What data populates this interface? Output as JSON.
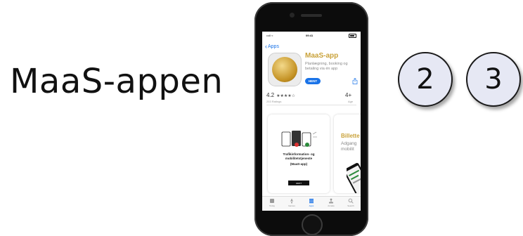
{
  "slide": {
    "title": "MaaS-appen",
    "steps": [
      "2",
      "3"
    ]
  },
  "status_bar": {
    "time": "09:41",
    "signal": "•••ll ≈"
  },
  "store": {
    "back_label": "Apps",
    "app_name": "MaaS-app",
    "app_subtitle": "Planlægning, booking og betaling via én app",
    "get_label": "HENT",
    "rating": "4.2",
    "stars": "★★★★☆",
    "ratings_count": "253 Ratings",
    "age": "4+",
    "age_label": "Age"
  },
  "cards": {
    "card1_title": "Trafikinformation- og mobilitetstjeneste",
    "card1_sub": "(MaaS-app)",
    "card1_button": "HENT",
    "card2_title": "Billette",
    "card2_line1": "Adgang",
    "card2_line2": "mobilit"
  },
  "tabs": [
    {
      "id": "today",
      "label": "Today"
    },
    {
      "id": "games",
      "label": "Games"
    },
    {
      "id": "apps",
      "label": "Apps"
    },
    {
      "id": "arcade",
      "label": "Arcade"
    },
    {
      "id": "search",
      "label": "Search"
    }
  ],
  "colors": {
    "accent_blue": "#1a73e8",
    "brand_gold": "#c9a23a",
    "circle_fill": "#e6e8f4"
  }
}
